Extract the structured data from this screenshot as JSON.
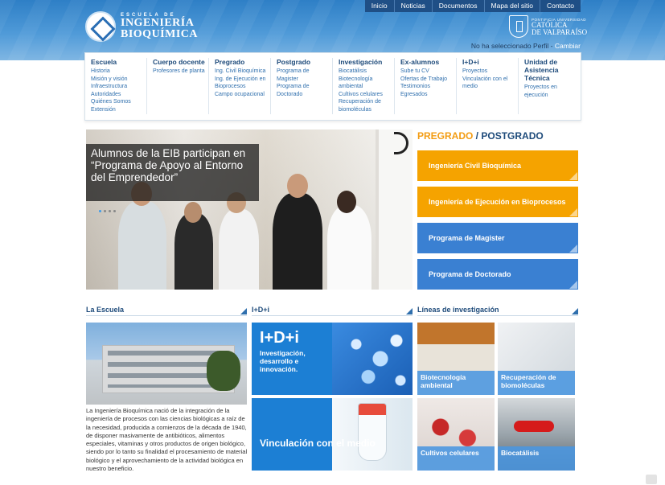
{
  "header": {
    "logo_small": "ESCUELA DE",
    "logo_line1": "INGENIERÍA",
    "logo_line2": "BIOQUÍMICA",
    "topnav": [
      "Inicio",
      "Noticias",
      "Documentos",
      "Mapa del sitio",
      "Contacto"
    ],
    "pucv_small": "PONTIFICIA UNIVERSIDAD",
    "pucv_line1": "CATÓLICA",
    "pucv_line2": "DE VALPARAÍSO",
    "perfil_text": "No ha seleccionado Perfil - ",
    "perfil_link": "Cambiar"
  },
  "menu": [
    {
      "head": "Escuela",
      "items": [
        "Historia",
        "Misión y visión",
        "Infraestructura",
        "Autoridades",
        "Quiénes Somos",
        "Extensión"
      ]
    },
    {
      "head": "Cuerpo docente",
      "items": [
        "Profesores de planta"
      ]
    },
    {
      "head": "Pregrado",
      "items": [
        "Ing. Civil Bioquímica",
        "Ing. de Ejecución en",
        "Bioprocesos",
        "Campo ocupacional"
      ]
    },
    {
      "head": "Postgrado",
      "items": [
        "Programa de",
        "Magister",
        "Programa de",
        "Doctorado"
      ]
    },
    {
      "head": "Investigación",
      "items": [
        "Biocatálisis",
        "Biotecnología",
        "ambiental",
        "Cultivos celulares",
        "Recuperación de",
        "biomoléculas"
      ]
    },
    {
      "head": "Ex-alumnos",
      "items": [
        "Sube tu CV",
        "Ofertas de Trabajo",
        "Testimonios",
        "Egresados"
      ]
    },
    {
      "head": "I+D+i",
      "items": [
        "Proyectos",
        "Vinculación con el",
        "medio"
      ]
    },
    {
      "head": "Unidad de Asistencia Técnica",
      "items": [
        "Proyectos en",
        "ejecución"
      ]
    }
  ],
  "slider": {
    "caption": "Alumnos de la EIB participan en “Programa de Apoyo al Entorno del Emprendedor”",
    "dots": 4,
    "active_dot": 0
  },
  "programs": {
    "title_pre": "PREGRADO",
    "title_sep": " / ",
    "title_post": "POSTGRADO",
    "buttons": [
      {
        "label": "Ingeniería Civil Bioquímica",
        "color": "#f5a300"
      },
      {
        "label": "Ingeniería de Ejecución en Bioprocesos",
        "color": "#f5a300"
      },
      {
        "label": "Programa de Magister",
        "color": "#3a80d2"
      },
      {
        "label": "Programa de Doctorado",
        "color": "#3a80d2"
      }
    ]
  },
  "sections": {
    "escuela_title": "La Escuela",
    "idi_title": "I+D+i",
    "lineas_title": "Líneas de investigación"
  },
  "escuela": {
    "text": "La Ingeniería Bioquímica nació de la integración de la ingeniería de procesos con las ciencias biológicas a raíz de la necesidad, producida a comienzos de la década de 1940, de disponer masivamente de antibióticos, alimentos especiales, vitaminas y otros productos de origen biológico, siendo por lo tanto su finalidad el procesamiento de material biológico y el aprovechamiento de la actividad biológica en nuestro beneficio."
  },
  "idi": {
    "big": "I+D+i",
    "small": "Investigación, desarrollo e innovación.",
    "vinculacion": "Vinculación con el medio"
  },
  "lineas": [
    {
      "label": "Biotecnología ambiental"
    },
    {
      "label": "Recuperación de biomoléculas"
    },
    {
      "label": "Cultivos celulares"
    },
    {
      "label": "Biocatálisis"
    }
  ]
}
